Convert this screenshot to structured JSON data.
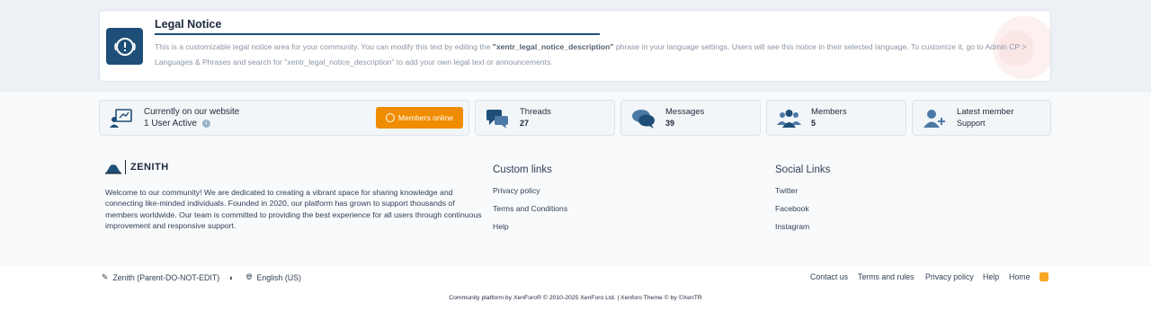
{
  "notice": {
    "title": "Legal Notice",
    "text_before": "This is a customizable legal notice area for your community. You can modify this text by editing the ",
    "phrase": "\"xentr_legal_notice_description\"",
    "text_after": " phrase in your language settings. Users will see this notice in their selected language. To customize it, go to Admin CP > Languages & Phrases and search for \"xentr_legal_notice_description\" to add your own legal text or announcements.",
    "icon": "exclamation-bubble-icon"
  },
  "stats": {
    "online": {
      "label": "Currently on our website",
      "value": "1 User Active",
      "button": "Members online"
    },
    "threads": {
      "label": "Threads",
      "value": "27"
    },
    "messages": {
      "label": "Messages",
      "value": "39"
    },
    "members": {
      "label": "Members",
      "value": "5"
    },
    "latest": {
      "label": "Latest member",
      "value": "Support"
    }
  },
  "footer": {
    "brand": "ZENITH",
    "about": "Welcome to our community! We are dedicated to creating a vibrant space for sharing knowledge and connecting like-minded individuals. Founded in 2020, our platform has grown to support thousands of members worldwide. Our team is committed to providing the best experience for all users through continuous improvement and responsive support.",
    "custom_links": {
      "title": "Custom links",
      "items": [
        "Privacy policy",
        "Terms and Conditions",
        "Help"
      ]
    },
    "social_links": {
      "title": "Social Links",
      "items": [
        "Twitter",
        "Facebook",
        "Instagram"
      ]
    }
  },
  "bottom": {
    "style": "Zenith (Parent-DO-NOT-EDIT)",
    "language": "English (US)",
    "links": [
      "Contact us",
      "Terms and rules",
      "Privacy policy",
      "Help",
      "Home"
    ],
    "copyright": "Community platform by XenForo® © 2010-2025 XenForo Ltd. | Xenforo Theme © by ©XenTR"
  },
  "colors": {
    "accent": "#1f4f78",
    "button": "#f08c00",
    "rss": "#f9a825"
  }
}
